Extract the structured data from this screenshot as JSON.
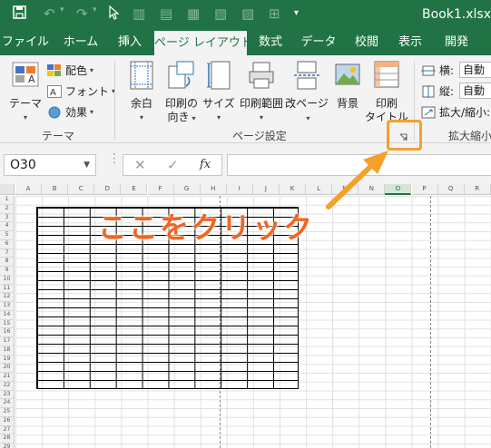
{
  "window": {
    "title": "Book1.xlsx"
  },
  "tabs": [
    {
      "label": "ファイル"
    },
    {
      "label": "ホーム"
    },
    {
      "label": "挿入"
    },
    {
      "label": "ページ レイアウト",
      "active": true
    },
    {
      "label": "数式"
    },
    {
      "label": "データ"
    },
    {
      "label": "校閲"
    },
    {
      "label": "表示"
    },
    {
      "label": "開発"
    }
  ],
  "ribbon": {
    "theme_group": {
      "label": "テーマ",
      "theme_button": "テーマ",
      "colors": "配色",
      "fonts": "フォント",
      "effects": "効果"
    },
    "page_setup_group": {
      "label": "ページ設定",
      "margins": "余白",
      "orientation_line1": "印刷の",
      "orientation_line2": "向き",
      "size": "サイズ",
      "print_area": "印刷範囲",
      "breaks": "改ページ",
      "background": "背景",
      "print_titles_line1": "印刷",
      "print_titles_line2": "タイトル"
    },
    "scale_group": {
      "label": "拡大縮小",
      "width_label": "横:",
      "width_value": "自動",
      "height_label": "縦:",
      "height_value": "自動",
      "scale_label": "拡大/縮小:"
    }
  },
  "formula_bar": {
    "name_box": "O30",
    "fx": "fx"
  },
  "columns": [
    "A",
    "B",
    "C",
    "D",
    "E",
    "F",
    "G",
    "H",
    "I",
    "J",
    "K",
    "L",
    "M",
    "N",
    "O",
    "P",
    "Q",
    "R"
  ],
  "selected_column": "O",
  "rows": [
    "1",
    "2",
    "3",
    "4",
    "5",
    "6",
    "7",
    "8",
    "9",
    "10",
    "11",
    "12",
    "13",
    "14",
    "15",
    "16",
    "17",
    "18",
    "19",
    "20",
    "21",
    "22",
    "23",
    "24",
    "25",
    "26",
    "27",
    "28",
    "29"
  ],
  "annotation": {
    "text": "ここをクリック",
    "color": "#f26522",
    "box_color": "#f5a02a"
  },
  "colors": {
    "excel_green": "#217346",
    "ribbon_bg": "#f3f3f3"
  }
}
